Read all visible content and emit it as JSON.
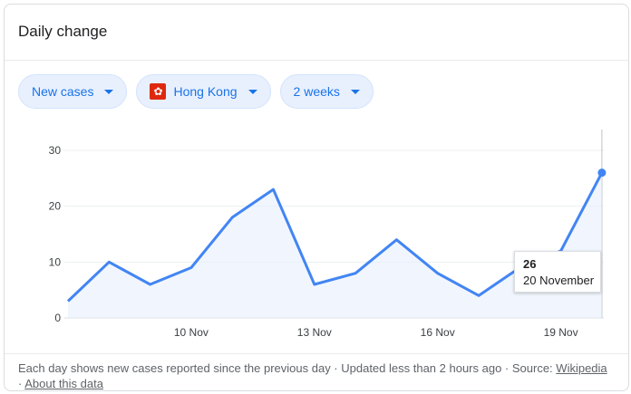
{
  "card": {
    "title": "Daily change"
  },
  "filters": {
    "metric": "New cases",
    "region": "Hong Kong",
    "region_flag_icon": "hong-kong-flag-icon",
    "period": "2 weeks"
  },
  "chart_data": {
    "type": "area",
    "x": [
      "7 Nov",
      "8 Nov",
      "9 Nov",
      "10 Nov",
      "11 Nov",
      "12 Nov",
      "13 Nov",
      "14 Nov",
      "15 Nov",
      "16 Nov",
      "17 Nov",
      "18 Nov",
      "19 Nov",
      "20 Nov"
    ],
    "values": [
      3,
      10,
      6,
      9,
      18,
      23,
      6,
      8,
      14,
      8,
      4,
      9,
      12,
      26
    ],
    "x_tick_labels": [
      "10 Nov",
      "13 Nov",
      "16 Nov",
      "19 Nov"
    ],
    "y_ticks": [
      0,
      10,
      20,
      30
    ],
    "ylim": [
      0,
      30
    ],
    "grid": true,
    "line_color": "#4285f4",
    "fill_color": "#e8f0fe"
  },
  "tooltip": {
    "value": "26",
    "date": "20 November"
  },
  "footer": {
    "text": "Each day shows new cases reported since the previous day · Updated less than 2 hours ago  ·  Source:",
    "source_link": "Wikipedia",
    "about_link": "About this data"
  }
}
